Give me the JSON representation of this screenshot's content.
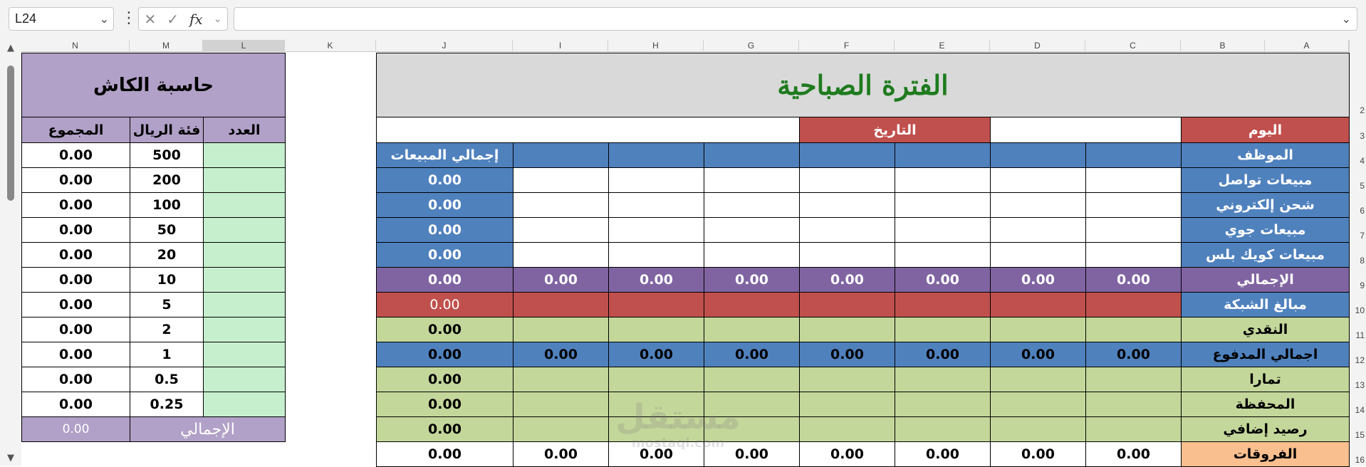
{
  "formula_bar": {
    "name_box": "L24",
    "fx_symbol": "fx",
    "formula_value": ""
  },
  "columns": [
    "N",
    "M",
    "L",
    "K",
    "J",
    "I",
    "H",
    "G",
    "F",
    "E",
    "D",
    "C",
    "B",
    "A"
  ],
  "selected_column": "L",
  "row_numbers": [
    "2",
    "3",
    "4",
    "5",
    "6",
    "7",
    "8",
    "9",
    "10",
    "11",
    "12",
    "13",
    "14",
    "15",
    "16"
  ],
  "colors": {
    "title_bg": "#d9d9d9",
    "title_text": "#1e7b1e",
    "blue": "#4f81bd",
    "red": "#c0504d",
    "purple": "#8064a2",
    "green": "#c4d79b",
    "orange": "#fabf8f",
    "lilac": "#b1a0c7",
    "mint": "#c6efce"
  },
  "sheet": {
    "title": "الفترة الصباحية",
    "day_label": "اليوم",
    "date_label": "التاريخ",
    "employee_label": "الموظف",
    "total_sales_header": "إجمالي المبيعات",
    "sales_rows": [
      {
        "label": "مبيعات تواصل",
        "total": "0.00"
      },
      {
        "label": "شحن إلكتروني",
        "total": "0.00"
      },
      {
        "label": "مبيعات جوي",
        "total": "0.00"
      },
      {
        "label": "مبيعات كويك بلس",
        "total": "0.00"
      }
    ],
    "total_row": {
      "label": "الإجمالي",
      "values": [
        "0.00",
        "0.00",
        "0.00",
        "0.00",
        "0.00",
        "0.00",
        "0.00"
      ],
      "total": "0.00"
    },
    "network_row": {
      "label": "مبالغ الشبكة",
      "total": "0.00"
    },
    "cash_row": {
      "label": "النقدي",
      "total": "0.00"
    },
    "paid_row": {
      "label": "اجمالي المدفوع",
      "values": [
        "0.00",
        "0.00",
        "0.00",
        "0.00",
        "0.00",
        "0.00",
        "0.00"
      ],
      "total": "0.00"
    },
    "tamara_row": {
      "label": "تمارا",
      "total": "0.00"
    },
    "wallet_row": {
      "label": "المحفظة",
      "total": "0.00"
    },
    "extra_row": {
      "label": "رصيد إضافي",
      "total": "0.00"
    },
    "diff_row": {
      "label": "الفروقات",
      "values": [
        "0.00",
        "0.00",
        "0.00",
        "0.00",
        "0.00",
        "0.00",
        "0.00"
      ],
      "total": "0.00"
    }
  },
  "cash_calc": {
    "title": "حاسبة الكاش",
    "headers": {
      "count": "العدد",
      "denomination": "فئة الريال",
      "sum": "المجموع"
    },
    "rows": [
      {
        "denomination": "500",
        "sum": "0.00"
      },
      {
        "denomination": "200",
        "sum": "0.00"
      },
      {
        "denomination": "100",
        "sum": "0.00"
      },
      {
        "denomination": "50",
        "sum": "0.00"
      },
      {
        "denomination": "20",
        "sum": "0.00"
      },
      {
        "denomination": "10",
        "sum": "0.00"
      },
      {
        "denomination": "5",
        "sum": "0.00"
      },
      {
        "denomination": "2",
        "sum": "0.00"
      },
      {
        "denomination": "1",
        "sum": "0.00"
      },
      {
        "denomination": "0.5",
        "sum": "0.00"
      },
      {
        "denomination": "0.25",
        "sum": "0.00"
      }
    ],
    "total_label": "الإجمالي",
    "total_value": "0.00"
  },
  "watermark": {
    "top": "مستقل",
    "bottom": "mostaql.com"
  }
}
